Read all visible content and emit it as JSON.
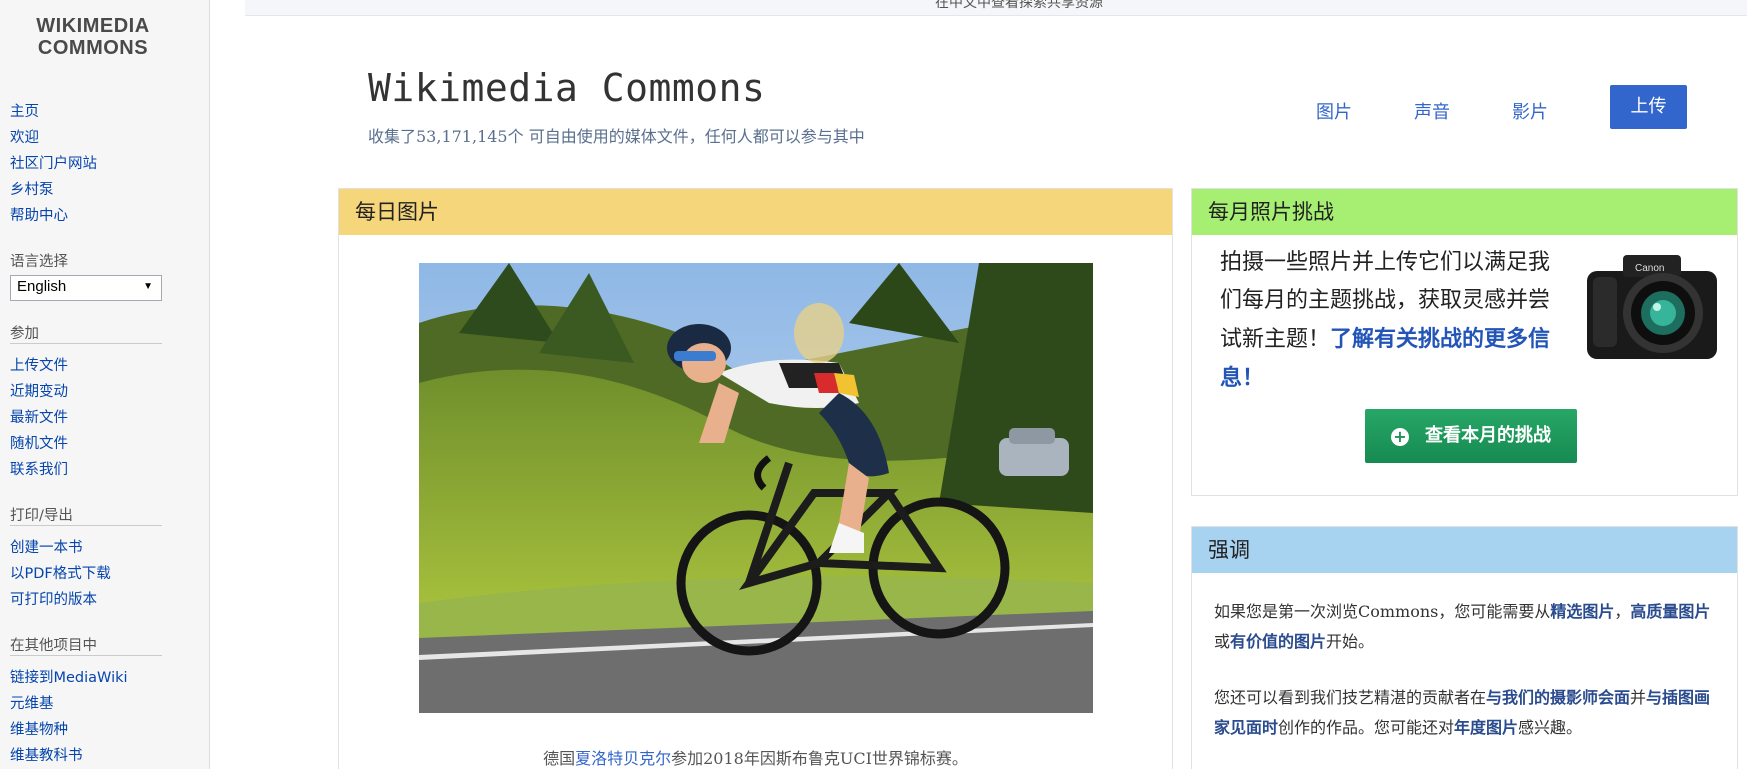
{
  "sidebar": {
    "logo_line1": "WIKIMEDIA",
    "logo_line2": "COMMONS",
    "nav": [
      "主页",
      "欢迎",
      "社区门户网站",
      "乡村泵",
      "帮助中心"
    ],
    "language_heading": "语言选择",
    "language_selected": "English",
    "participate_heading": "参加",
    "participate": [
      "上传文件",
      "近期变动",
      "最新文件",
      "随机文件",
      "联系我们"
    ],
    "print_heading": "打印/导出",
    "print": [
      "创建一本书",
      "以PDF格式下载",
      "可打印的版本"
    ],
    "other_heading": "在其他项目中",
    "other": [
      "链接到MediaWiki",
      "元维基",
      "维基物种",
      "维基教科书"
    ]
  },
  "banner_text": "在中文中查看探索共享资源",
  "header": {
    "title": "Wikimedia Commons",
    "subtitle": "收集了53,171,145个 可自由使用的媒体文件，任何人都可以参与其中",
    "nav": [
      "图片",
      "声音",
      "影片"
    ],
    "upload": "上传"
  },
  "potd": {
    "heading": "每日图片",
    "caption_pre": "德国",
    "caption_link": "夏洛特贝克尔",
    "caption_post": "参加2018年因斯布鲁克UCI世界锦标赛。"
  },
  "challenge": {
    "heading": "每月照片挑战",
    "text": "拍摄一些照片并上传它们以满足我们每月的主题挑战，获取灵感并尝试新主题！",
    "link": "了解有关挑战的更多信息！",
    "button": "查看本月的挑战",
    "camera_label": "Canon"
  },
  "highlight": {
    "heading": "强调",
    "p1_pre": "如果您是第一次浏览Commons，您可能需要从",
    "p1_link1": "精选图片",
    "p1_mid": "，",
    "p1_link2": "高质量图片",
    "p1_mid2": "或",
    "p1_link3": "有价值的图片",
    "p1_post": "开始。",
    "p2_pre": "您还可以看到我们技艺精湛的贡献者在",
    "p2_link1": "与我们的摄影师会面",
    "p2_mid": "并",
    "p2_link2": "与插图画家见面时",
    "p2_mid2": "创作的作品。您可能还对",
    "p2_link3": "年度图片",
    "p2_post": "感兴趣。"
  }
}
